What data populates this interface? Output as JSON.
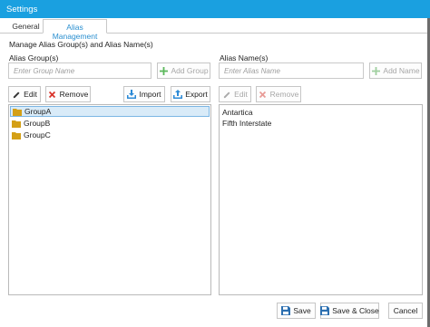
{
  "window": {
    "title": "Settings"
  },
  "tabs": [
    {
      "label": "General"
    },
    {
      "label": "Alias Management"
    }
  ],
  "section_title": "Manage Alias Group(s) and Alias Name(s)",
  "groups_panel": {
    "label": "Alias Group(s)",
    "input_placeholder": "Enter Group Name",
    "add_label": "Add Group",
    "edit_label": "Edit",
    "remove_label": "Remove",
    "import_label": "Import",
    "export_label": "Export",
    "items": [
      {
        "label": "GroupA",
        "selected": true
      },
      {
        "label": "GroupB",
        "selected": false
      },
      {
        "label": "GroupC",
        "selected": false
      }
    ]
  },
  "names_panel": {
    "label": "Alias Name(s)",
    "input_placeholder": "Enter Alias Name",
    "add_label": "Add Name",
    "edit_label": "Edit",
    "remove_label": "Remove",
    "items": [
      {
        "label": "Antartica"
      },
      {
        "label": "Fifth Interstate"
      }
    ]
  },
  "footer": {
    "save_label": "Save",
    "save_close_label": "Save & Close",
    "cancel_label": "Cancel"
  },
  "colors": {
    "titlebar": "#1aa0e0",
    "tab_active_text": "#2a8fd0",
    "add_icon": "#5cb85c",
    "remove_icon": "#d9342b",
    "folder_icon": "#d4a017",
    "import_export_icon": "#2c8ad6"
  }
}
